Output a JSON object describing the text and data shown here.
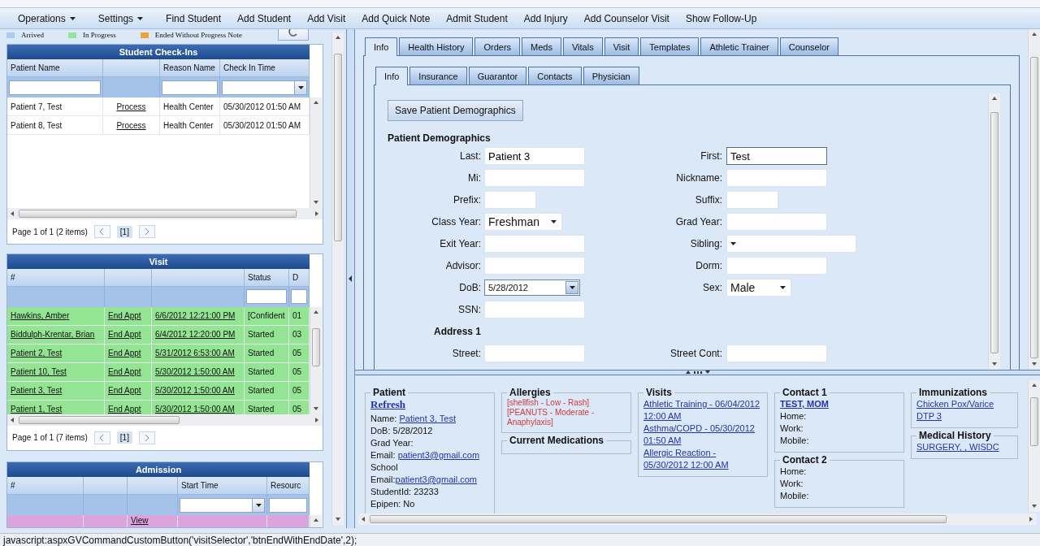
{
  "menu": [
    {
      "label": "Operations",
      "kind": "dropdown"
    },
    {
      "label": "Settings",
      "kind": "dropdown"
    },
    {
      "label": "Find Student",
      "kind": "link"
    },
    {
      "label": "Add Student",
      "kind": "link"
    },
    {
      "label": "Add Visit",
      "kind": "link"
    },
    {
      "label": "Add Quick Note",
      "kind": "link"
    },
    {
      "label": "Admit Student",
      "kind": "link"
    },
    {
      "label": "Add Injury",
      "kind": "link"
    },
    {
      "label": "Add Counselor Visit",
      "kind": "link"
    },
    {
      "label": "Show Follow-Up",
      "kind": "link"
    }
  ],
  "legend": [
    {
      "label": "Arrived",
      "color": "#a9cdf2"
    },
    {
      "label": "In Progress",
      "color": "#98e39a"
    },
    {
      "label": "Ended Without Progress Note",
      "color": "#f0a33a"
    }
  ],
  "grids": [
    {
      "title": "Student Check-Ins",
      "columns": [
        {
          "label": "Patient Name",
          "filter": {
            "kind": "text"
          }
        },
        {},
        {
          "label": "Reason Name",
          "filter": {
            "kind": "text"
          }
        },
        {
          "label": "Check In Time",
          "filter": {
            "kind": "date"
          }
        }
      ],
      "rows": [
        {
          "cells": [
            {
              "text": "Patient 7, Test",
              "kind": "plain"
            },
            {
              "text": "Process",
              "kind": "link"
            },
            {
              "text": "Health Center",
              "kind": "plain"
            },
            {
              "text": "05/30/2012 01:50 AM",
              "kind": "plain"
            }
          ]
        },
        {
          "cells": [
            {
              "text": "Patient 8, Test",
              "kind": "plain"
            },
            {
              "text": "Process",
              "kind": "link"
            },
            {
              "text": "Health Center",
              "kind": "plain"
            },
            {
              "text": "05/30/2012 01:50 AM",
              "kind": "plain"
            }
          ]
        }
      ],
      "pager": {
        "summary": "Page 1 of 1 (2 items)",
        "page": "[1]"
      }
    },
    {
      "title": "Visit",
      "columns": [
        {
          "label": "#"
        },
        {},
        {},
        {
          "label": "Status",
          "filter": {
            "kind": "text"
          }
        },
        {
          "label": "D",
          "filter": {
            "kind": "text"
          }
        }
      ],
      "rows": [
        {
          "color": "#93e493",
          "cells": [
            {
              "text": "Hawkins, Amber",
              "kind": "link"
            },
            {
              "text": "End Appt",
              "kind": "link"
            },
            {
              "text": "6/6/2012 12:21:00 PM",
              "kind": "link"
            },
            {
              "text": "[Confident",
              "kind": "plain"
            },
            {
              "text": "01",
              "kind": "plain"
            }
          ]
        },
        {
          "color": "#93e493",
          "cells": [
            {
              "text": "Biddulph-Krentar, Brian",
              "kind": "link"
            },
            {
              "text": "End Appt",
              "kind": "link"
            },
            {
              "text": "6/4/2012 12:20:00 PM",
              "kind": "link"
            },
            {
              "text": "Started",
              "kind": "plain"
            },
            {
              "text": "03",
              "kind": "plain"
            }
          ]
        },
        {
          "color": "#93e493",
          "cells": [
            {
              "text": "Patient 2, Test",
              "kind": "link"
            },
            {
              "text": "End Appt",
              "kind": "link"
            },
            {
              "text": "5/31/2012 6:53:00 AM",
              "kind": "link"
            },
            {
              "text": "Started",
              "kind": "plain"
            },
            {
              "text": "05",
              "kind": "plain"
            }
          ]
        },
        {
          "color": "#93e493",
          "cells": [
            {
              "text": "Patient 10, Test",
              "kind": "link"
            },
            {
              "text": "End Appt",
              "kind": "link"
            },
            {
              "text": "5/30/2012 1:50:00 AM",
              "kind": "link"
            },
            {
              "text": "Started",
              "kind": "plain"
            },
            {
              "text": "05",
              "kind": "plain"
            }
          ]
        },
        {
          "color": "#93e493",
          "cells": [
            {
              "text": "Patient 3, Test",
              "kind": "link"
            },
            {
              "text": "End Appt",
              "kind": "link"
            },
            {
              "text": "5/30/2012 1:50:00 AM",
              "kind": "link"
            },
            {
              "text": "Started",
              "kind": "plain"
            },
            {
              "text": "05",
              "kind": "plain"
            }
          ]
        },
        {
          "color": "#93e493",
          "cells": [
            {
              "text": "Patient 1, Test",
              "kind": "link"
            },
            {
              "text": "End Appt",
              "kind": "link"
            },
            {
              "text": "5/30/2012 1:50:00 AM",
              "kind": "link"
            },
            {
              "text": "Started",
              "kind": "plain"
            },
            {
              "text": "05",
              "kind": "plain"
            }
          ]
        }
      ],
      "pager": {
        "summary": "Page 1 of 1 (7 items)",
        "page": "[1]"
      }
    },
    {
      "title": "Admission",
      "columns": [
        {
          "label": "#"
        },
        {},
        {},
        {
          "label": "Start Time",
          "filter": {
            "kind": "date"
          }
        },
        {
          "label": "Resourc",
          "filter": {
            "kind": "text"
          }
        }
      ],
      "rows": [
        {
          "color": "#dca4dc",
          "cells": [
            {},
            {},
            {
              "text": "View",
              "kind": "link"
            },
            {},
            {}
          ]
        }
      ]
    }
  ],
  "tabs": [
    {
      "label": "Info",
      "selected": true
    },
    {
      "label": "Health History",
      "selected": false
    },
    {
      "label": "Orders",
      "selected": false
    },
    {
      "label": "Meds",
      "selected": false
    },
    {
      "label": "Vitals",
      "selected": false
    },
    {
      "label": "Visit",
      "selected": false
    },
    {
      "label": "Templates",
      "selected": false
    },
    {
      "label": "Athletic Trainer",
      "selected": false
    },
    {
      "label": "Counselor",
      "selected": false
    }
  ],
  "subtabs": [
    {
      "label": "Info",
      "selected": true
    },
    {
      "label": "Insurance",
      "selected": false
    },
    {
      "label": "Guarantor",
      "selected": false
    },
    {
      "label": "Contacts",
      "selected": false
    },
    {
      "label": "Physician",
      "selected": false
    }
  ],
  "save_button": "Save Patient Demographics",
  "form_title": "Patient Demographics",
  "form_rows": [
    {
      "kind": "fields",
      "left": {
        "label": "Last:",
        "kind": "text",
        "value": "Patient 3"
      },
      "right": {
        "label": "First:",
        "kind": "text",
        "value": "Test",
        "focused": true
      }
    },
    {
      "kind": "fields",
      "left": {
        "label": "Mi:",
        "kind": "text"
      },
      "right": {
        "label": "Nickname:",
        "kind": "text"
      }
    },
    {
      "kind": "fields",
      "left": {
        "label": "Prefix:",
        "kind": "text",
        "short": true
      },
      "right": {
        "label": "Suffix:",
        "kind": "text",
        "short": true
      }
    },
    {
      "kind": "fields",
      "left": {
        "label": "Class Year:",
        "kind": "select",
        "value": "Freshman"
      },
      "right": {
        "label": "Grad Year:",
        "kind": "text"
      }
    },
    {
      "kind": "fields",
      "left": {
        "label": "Exit Year:",
        "kind": "text"
      },
      "right": {
        "label": "Sibling:",
        "kind": "select",
        "wide": true
      }
    },
    {
      "kind": "fields",
      "left": {
        "label": "Advisor:",
        "kind": "text"
      },
      "right": {
        "label": "Dorm:",
        "kind": "text"
      }
    },
    {
      "kind": "fields",
      "left": {
        "label": "DoB:",
        "kind": "date",
        "value": "5/28/2012"
      },
      "right": {
        "label": "Sex:",
        "kind": "select",
        "value": "Male",
        "short": true
      }
    },
    {
      "kind": "fields",
      "left": {
        "label": "SSN:",
        "kind": "text"
      }
    },
    {
      "kind": "heading",
      "label": "Address 1"
    },
    {
      "kind": "fields",
      "left": {
        "label": "Street:",
        "kind": "text"
      },
      "right": {
        "label": "Street Cont:",
        "kind": "text"
      }
    }
  ],
  "summary": {
    "patient": {
      "title": "Patient",
      "refresh": "Refresh",
      "lines": [
        {
          "text": "Name: ",
          "link": "Patient 3, Test"
        },
        {
          "text": "DoB: 5/28/2012"
        },
        {
          "text": "Grad Year:"
        },
        {
          "text": "Email: ",
          "link": "patient3@gmail.com"
        },
        {
          "text": "School Email:",
          "link": "patient3@gmail.com"
        },
        {
          "text": "StudentId: 23233"
        },
        {
          "text": "Epipen: No"
        }
      ]
    },
    "allergies": {
      "title": "Allergies",
      "text": "[shellfish - Low - Rash][PEANUTS - Moderate - Anaphylaxis]"
    },
    "medications": {
      "title": "Current Medications"
    },
    "visits": {
      "title": "Visits",
      "links": [
        "Athletic Training - 06/04/2012 12:00 AM",
        "Asthma/COPD - 05/30/2012 01:50 AM",
        "Allergic Reaction - 05/30/2012 12:00 AM"
      ]
    },
    "contacts": [
      {
        "title": "Contact 1",
        "name": "TEST, MOM",
        "lines": [
          "Home:",
          "Work:",
          "Mobile:"
        ]
      },
      {
        "title": "Contact 2",
        "lines": [
          "Home:",
          "Work:",
          "Mobile:"
        ]
      }
    ],
    "immunizations": {
      "title": "Immunizations",
      "links": [
        "Chicken Pox/Varice",
        "DTP 3"
      ]
    },
    "medical_history": {
      "title": "Medical History",
      "links": [
        "SURGERY, , WISDC"
      ]
    }
  },
  "status_bar": "javascript:aspxGVCommandCustomButton('visitSelector','btnEndWithEndDate',2);"
}
